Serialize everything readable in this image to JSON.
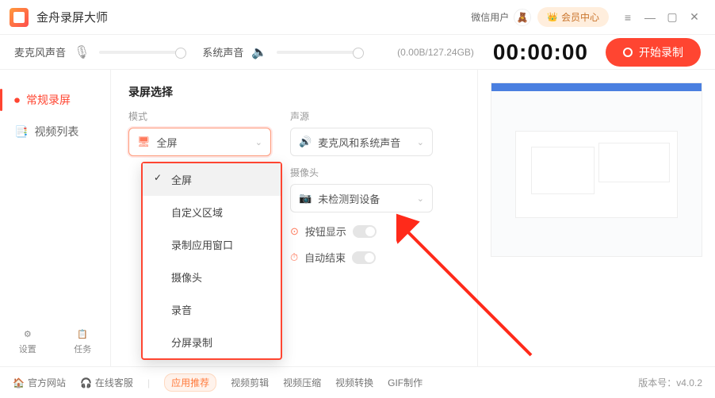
{
  "titlebar": {
    "app_name": "金舟录屏大师",
    "wx_user": "微信用户",
    "vip_label": "会员中心"
  },
  "audio": {
    "mic_label": "麦克风声音",
    "sys_label": "系统声音",
    "storage": "(0.00B/127.24GB)",
    "timer": "00:00:00",
    "record_btn": "开始录制"
  },
  "sidebar": {
    "normal": "常规录屏",
    "list": "视频列表",
    "settings": "设置",
    "tasks": "任务"
  },
  "main": {
    "title": "录屏选择",
    "mode_label": "模式",
    "mode_value": "全屏",
    "src_label": "声源",
    "src_value": "麦克风和系统声音",
    "cam_label": "摄像头",
    "cam_value": "未检测到设备",
    "btn_show": "按钮显示",
    "auto_end": "自动结束"
  },
  "dropdown": {
    "items": [
      "全屏",
      "自定义区域",
      "录制应用窗口",
      "摄像头",
      "录音",
      "分屏录制"
    ]
  },
  "footer": {
    "official": "官方网站",
    "service": "在线客服",
    "rec": "应用推荐",
    "edit": "视频剪辑",
    "compress": "视频压缩",
    "convert": "视频转换",
    "gif": "GIF制作",
    "version": "版本号：v4.0.2"
  }
}
